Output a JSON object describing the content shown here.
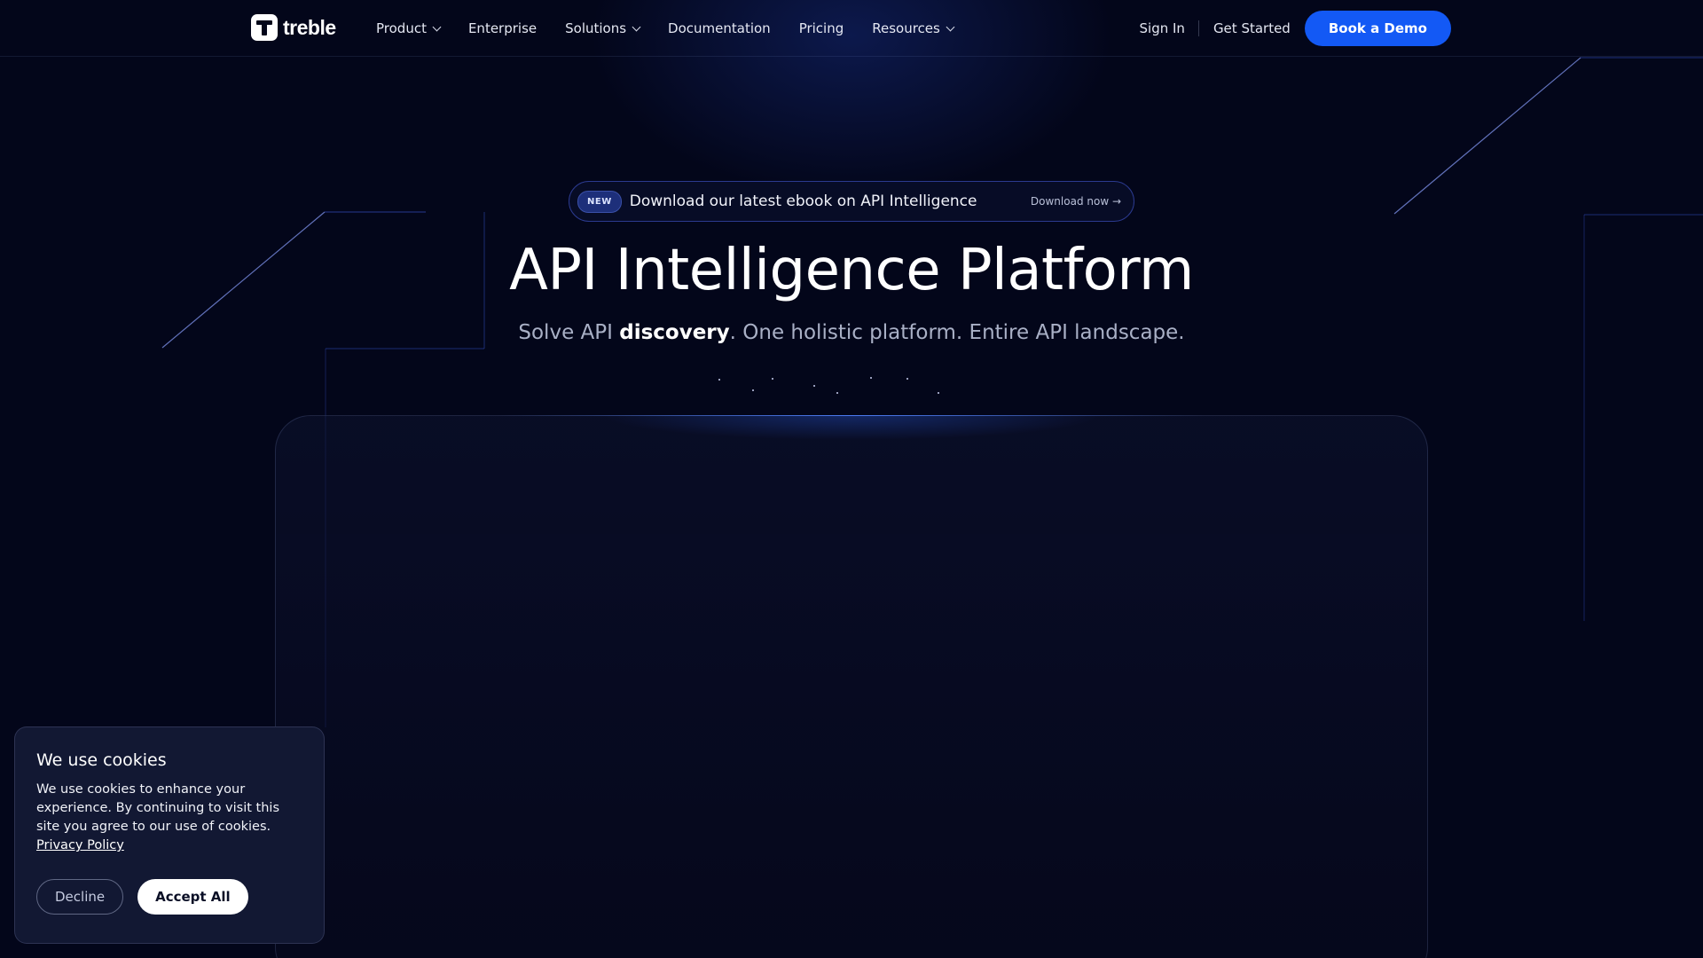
{
  "brand": {
    "name": "treble"
  },
  "nav": {
    "items": [
      {
        "label": "Product",
        "has_dropdown": true
      },
      {
        "label": "Enterprise",
        "has_dropdown": false
      },
      {
        "label": "Solutions",
        "has_dropdown": true
      },
      {
        "label": "Documentation",
        "has_dropdown": false
      },
      {
        "label": "Pricing",
        "has_dropdown": false
      },
      {
        "label": "Resources",
        "has_dropdown": true
      }
    ],
    "sign_in": "Sign In",
    "get_started": "Get Started",
    "book_demo": "Book a Demo"
  },
  "hero": {
    "badge": "NEW",
    "announcement": "Download our latest ebook on API Intelligence",
    "announcement_link": "Download now →",
    "title": "API Intelligence Platform",
    "subtitle_pre": "Solve API ",
    "subtitle_bold": "discovery",
    "subtitle_post": ". One holistic platform. Entire API landscape."
  },
  "cookie": {
    "title": "We use cookies",
    "body": "We use cookies to enhance your experience. By continuing to visit this site you agree to our use of cookies.",
    "link": "Privacy Policy",
    "decline": "Decline",
    "accept": "Accept All"
  },
  "colors": {
    "background": "#03061a",
    "accent": "#1359f5",
    "card": "#121833"
  },
  "icons": {
    "chevron": "chevron-down-icon",
    "logo": "treblle-logo-icon"
  }
}
